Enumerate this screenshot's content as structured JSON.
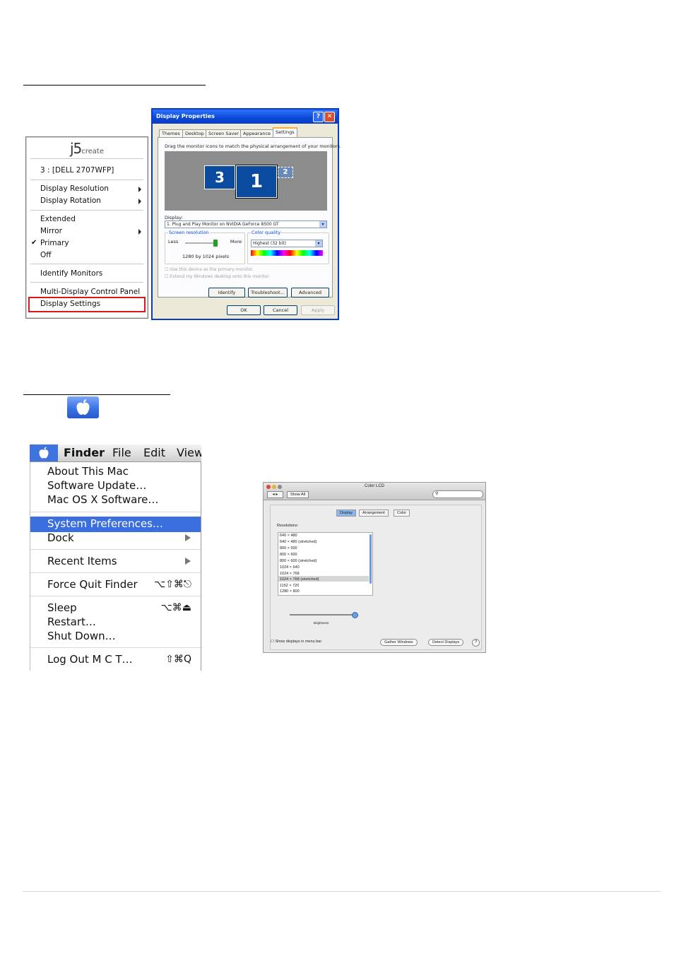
{
  "j5_menu": {
    "logo_main": "j5",
    "logo_sub": "create",
    "monitor": "3 : [DELL 2707WFP]",
    "items": {
      "display_resolution": "Display Resolution",
      "display_rotation": "Display Rotation",
      "extended": "Extended",
      "mirror": "Mirror",
      "primary": "Primary",
      "off": "Off",
      "identify_monitors": "Identify Monitors",
      "multi_display": "Multi-Display Control Panel",
      "display_settings": "Display Settings"
    },
    "check_mark": "✔",
    "highlight_color": "#d31b1b"
  },
  "display_properties": {
    "title": "Display Properties",
    "help_btn": "?",
    "close_btn": "✕",
    "tabs": [
      "Themes",
      "Desktop",
      "Screen Saver",
      "Appearance",
      "Settings"
    ],
    "selected_tab": "Settings",
    "instruction": "Drag the monitor icons to match the physical arrangement of your monitors.",
    "monitors": [
      "3",
      "1",
      "2"
    ],
    "display_label": "Display:",
    "display_value": "1. Plug and Play Monitor on NVIDIA GeForce 8500 GT",
    "screen_resolution_label": "Screen resolution",
    "less": "Less",
    "more": "More",
    "resolution_value": "1280 by 1024 pixels",
    "color_quality_label": "Color quality",
    "color_quality_value": "Highest (32 bit)",
    "use_primary": "Use this device as the primary monitor.",
    "extend_desktop": "Extend my Windows desktop onto this monitor.",
    "identify": "Identify",
    "troubleshoot": "Troubleshoot...",
    "advanced": "Advanced",
    "ok": "OK",
    "cancel": "Cancel",
    "apply": "Apply"
  },
  "apple_icon": {
    "icon": "apple-logo-icon",
    "color": "#3a73e6"
  },
  "mac_menu": {
    "menubar": {
      "finder": "Finder",
      "file": "File",
      "edit": "Edit",
      "view": "View"
    },
    "items": {
      "about": "About This Mac",
      "software_update": "Software Update…",
      "mac_os_software": "Mac OS X Software…",
      "system_preferences": "System Preferences…",
      "dock": "Dock",
      "recent_items": "Recent Items",
      "force_quit": "Force Quit Finder",
      "sleep": "Sleep",
      "restart": "Restart…",
      "shut_down": "Shut Down…",
      "log_out": "Log Out M C T…"
    },
    "shortcuts": {
      "force_quit": "⌥⇧⌘⎋",
      "sleep": "⌥⌘⏏",
      "log_out": "⇧⌘Q"
    },
    "highlight_color": "#3b6fe0"
  },
  "color_lcd": {
    "title": "Color LCD",
    "show_all": "Show All",
    "search_placeholder": "",
    "segments": [
      "Display",
      "Arrangement",
      "Color"
    ],
    "selected_segment": "Display",
    "resolutions_label": "Resolutions:",
    "resolutions": [
      "640 × 480",
      "640 × 480 (stretched)",
      "800 × 500",
      "800 × 600",
      "800 × 600 (stretched)",
      "1024 × 640",
      "1024 × 768",
      "1024 × 768 (stretched)",
      "1152 × 720",
      "1280 × 800"
    ],
    "selected_resolution": "1024 × 768 (stretched)",
    "brightness_label": "Brightness",
    "brightness_level": 1.0,
    "show_displays": "Show displays in menu bar",
    "gather_windows": "Gather Windows",
    "detect_displays": "Detect Displays",
    "help": "?"
  }
}
